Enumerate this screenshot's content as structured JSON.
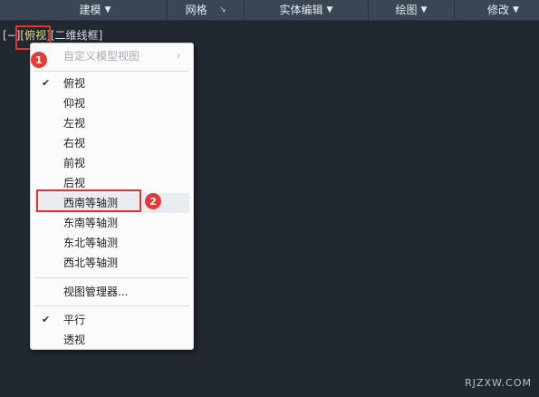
{
  "ribbon": {
    "tabs": [
      {
        "label": "建模",
        "has_dropdown": true
      },
      {
        "label": "网格",
        "has_dialog_launcher": true
      },
      {
        "label": "实体编辑",
        "has_dropdown": true
      },
      {
        "label": "绘图",
        "has_dropdown": true
      },
      {
        "label": "修改",
        "has_dropdown": true
      }
    ]
  },
  "viewport": {
    "control_label": "[−]",
    "view_label": "[俯视]",
    "style_label": "[二维线框]"
  },
  "menu": {
    "submenu_label": "自定义模型视图",
    "views": [
      "俯视",
      "仰视",
      "左视",
      "右视",
      "前视",
      "后视"
    ],
    "checked_view": "俯视",
    "iso_views": [
      "西南等轴测",
      "东南等轴测",
      "东北等轴测",
      "西北等轴测"
    ],
    "highlighted_item": "西南等轴测",
    "manager_label": "视图管理器...",
    "projections": [
      "平行",
      "透视"
    ],
    "checked_projection": "平行"
  },
  "annotations": {
    "step1": "1",
    "step2": "2",
    "color": "#e3312c"
  },
  "watermark": "RJZXW.COM",
  "colors": {
    "background": "#212830",
    "ribbon": "#3b4553",
    "view_label": "#f1df54",
    "menu_bg": "#fbfbfc"
  }
}
